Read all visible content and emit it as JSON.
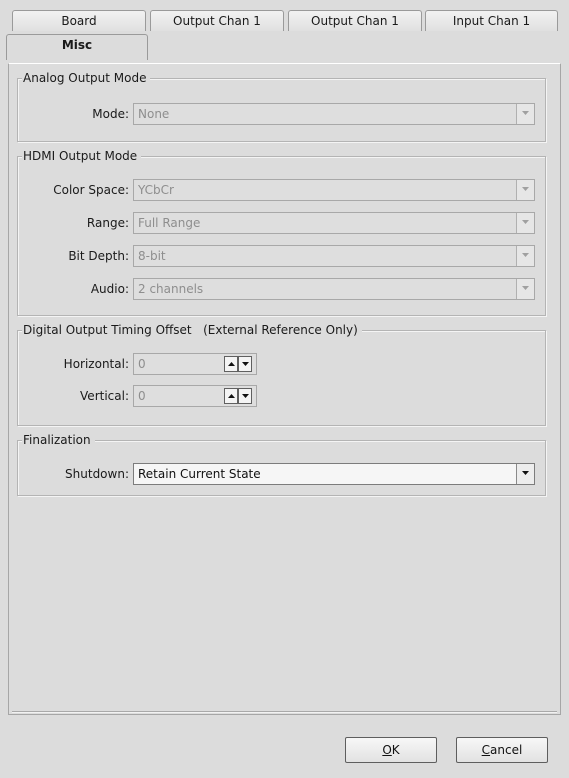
{
  "tabs": {
    "board": "Board",
    "output_chan_1a": "Output Chan 1",
    "output_chan_1b": "Output Chan 1",
    "input_chan_1": "Input Chan 1",
    "misc": "Misc"
  },
  "analog_output": {
    "title": "Analog Output Mode",
    "mode_label": "Mode:",
    "mode_value": "None"
  },
  "hdmi_output": {
    "title": "HDMI Output Mode",
    "color_space_label": "Color Space:",
    "color_space_value": "YCbCr",
    "range_label": "Range:",
    "range_value": "Full Range",
    "bit_depth_label": "Bit Depth:",
    "bit_depth_value": "8-bit",
    "audio_label": "Audio:",
    "audio_value": "2 channels"
  },
  "timing_offset": {
    "title": "Digital Output Timing Offset",
    "title_note": "(External Reference Only)",
    "horizontal_label": "Horizontal:",
    "horizontal_value": "0",
    "vertical_label": "Vertical:",
    "vertical_value": "0"
  },
  "finalization": {
    "title": "Finalization",
    "shutdown_label": "Shutdown:",
    "shutdown_value": "Retain Current State"
  },
  "buttons": {
    "ok_mnemonic": "O",
    "ok_rest": "K",
    "cancel_mnemonic": "C",
    "cancel_rest": "ancel"
  }
}
